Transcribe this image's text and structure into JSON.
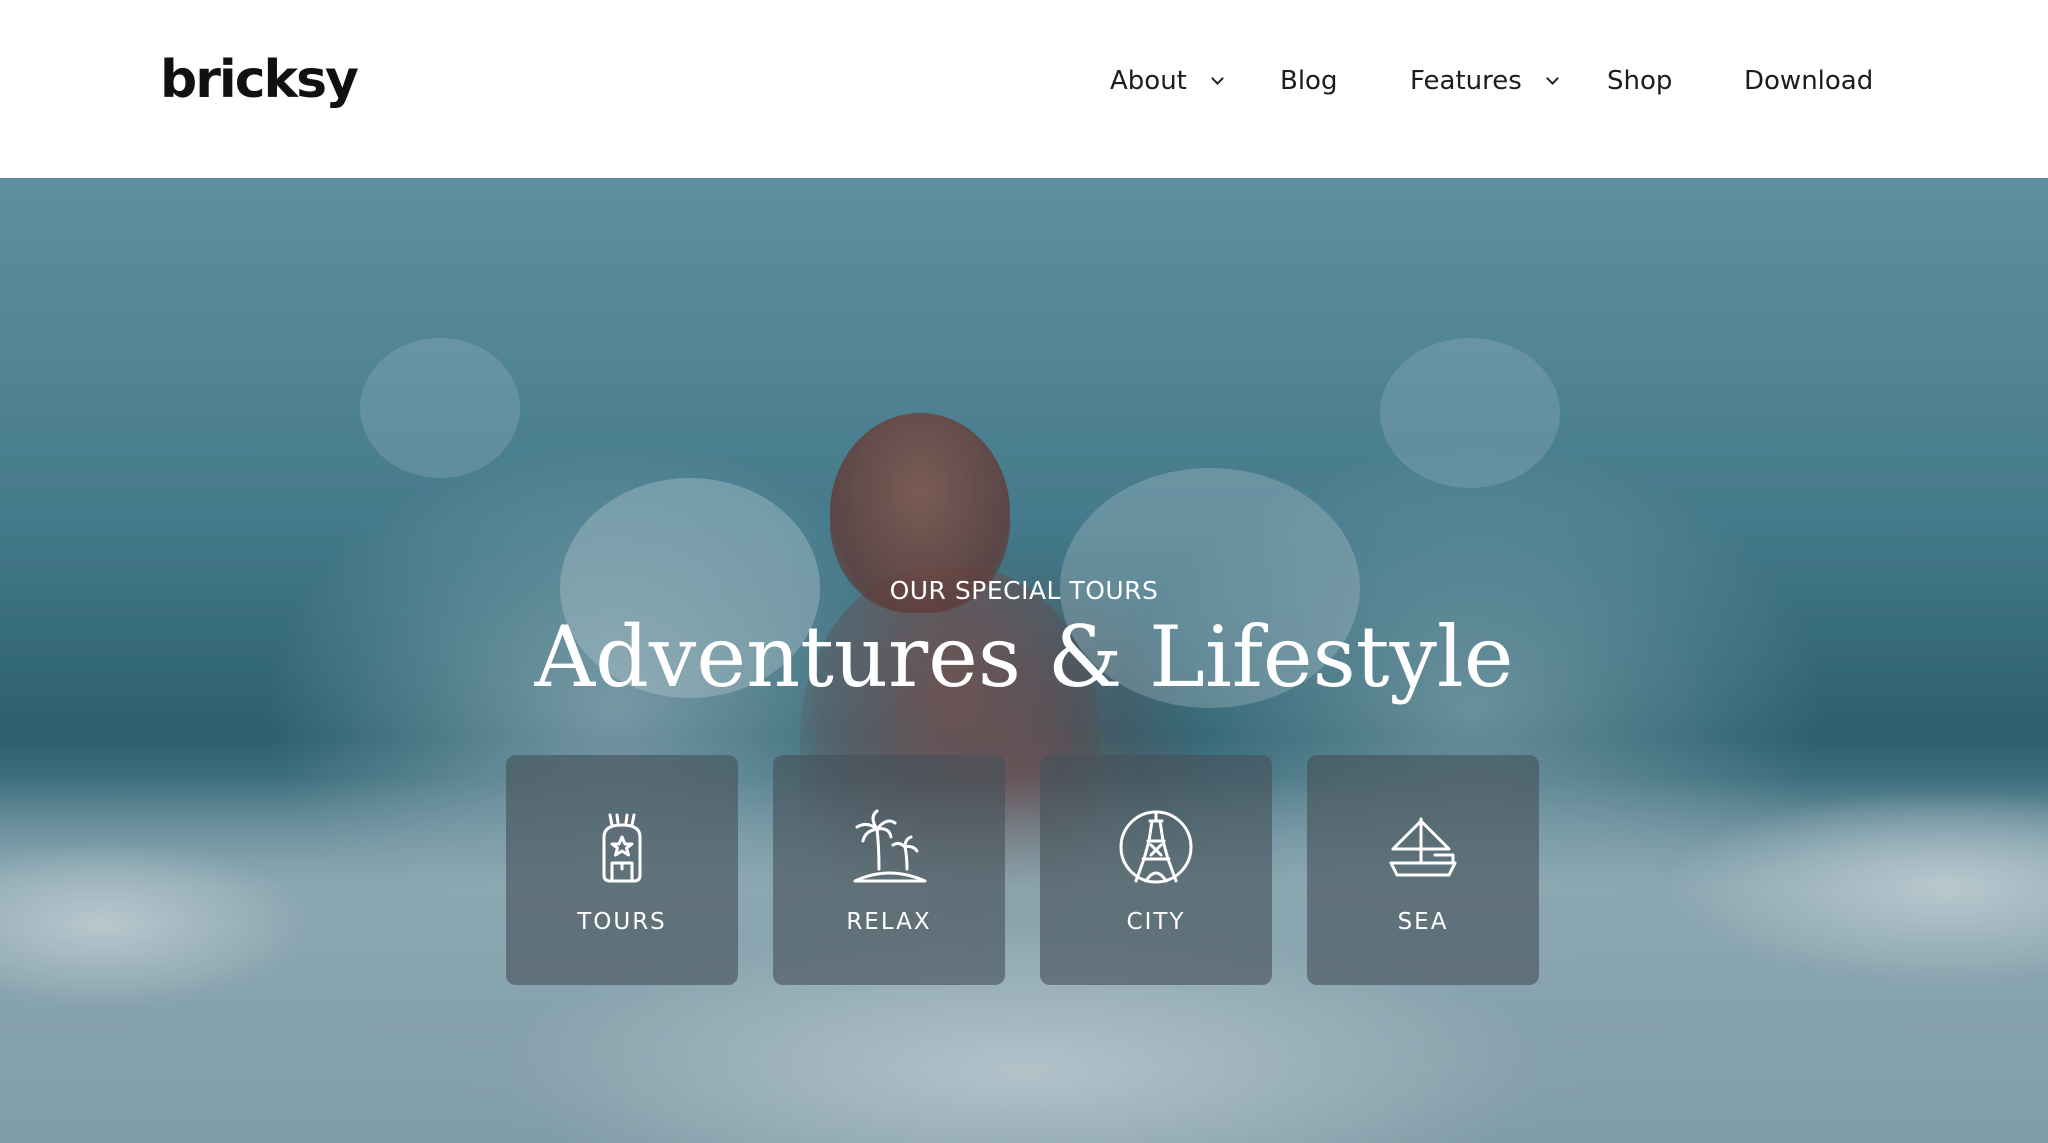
{
  "brand": {
    "logo_text": "bricksy"
  },
  "nav": {
    "items": [
      {
        "label": "About",
        "has_dropdown": true
      },
      {
        "label": "Blog",
        "has_dropdown": false
      },
      {
        "label": "Features",
        "has_dropdown": true
      },
      {
        "label": "Shop",
        "has_dropdown": false
      },
      {
        "label": "Download",
        "has_dropdown": false
      }
    ]
  },
  "hero": {
    "eyebrow": "OUR SPECIAL TOURS",
    "title": "Adventures & Lifestyle",
    "cards": [
      {
        "label": "TOURS",
        "icon": "backpack-icon"
      },
      {
        "label": "RELAX",
        "icon": "palm-island-icon"
      },
      {
        "label": "CITY",
        "icon": "eiffel-tower-icon"
      },
      {
        "label": "SEA",
        "icon": "sailboat-icon"
      }
    ]
  },
  "colors": {
    "header_bg": "#ffffff",
    "nav_text": "#1c1c1c",
    "hero_text": "#ffffff",
    "card_bg": "rgba(70,80,88,0.62)",
    "ocean": "#4f8a9b"
  }
}
